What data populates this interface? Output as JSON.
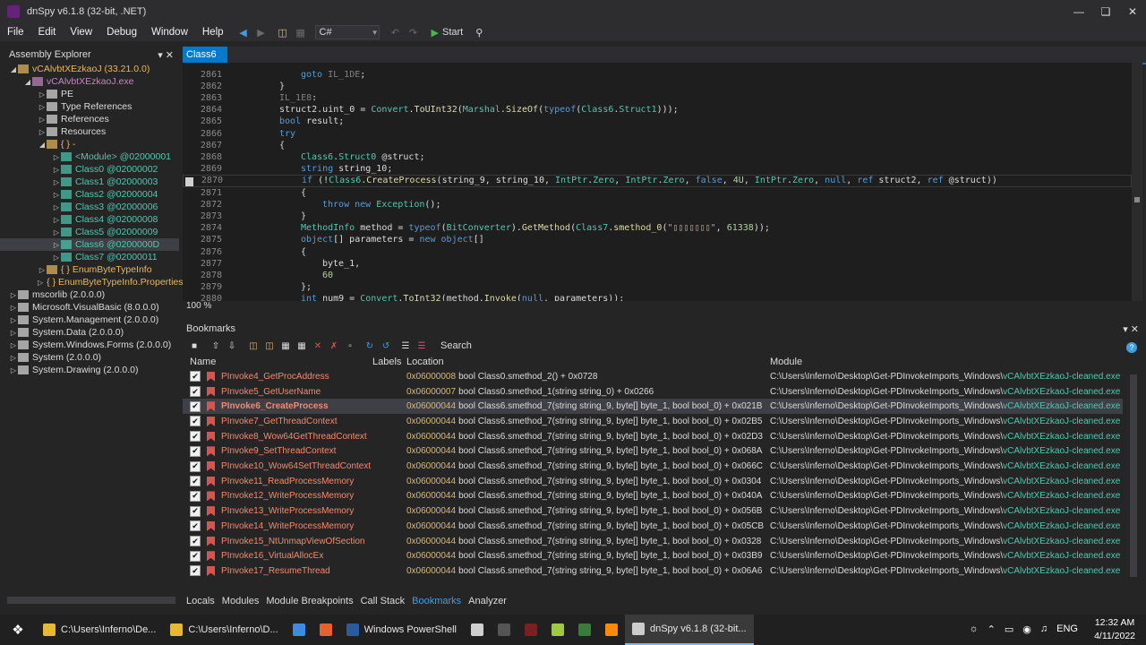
{
  "window": {
    "title": "dnSpy v6.1.8 (32-bit, .NET)"
  },
  "menu": [
    "File",
    "Edit",
    "View",
    "Debug",
    "Window",
    "Help"
  ],
  "toolbar": {
    "language": "C#",
    "start_label": "Start"
  },
  "assembly_explorer": {
    "title": "Assembly Explorer",
    "items": [
      {
        "label": "vCAlvbtXEzkaoJ (33.21.0.0)",
        "indent": 0,
        "color": "#e8b85a",
        "exp": "open"
      },
      {
        "label": "vCAlvbtXEzkaoJ.exe",
        "indent": 1,
        "color": "#c586c0",
        "exp": "open"
      },
      {
        "label": "PE",
        "indent": 2,
        "color": "#dcdcdc",
        "exp": "closed"
      },
      {
        "label": "Type References",
        "indent": 2,
        "color": "#dcdcdc",
        "exp": "closed"
      },
      {
        "label": "References",
        "indent": 2,
        "color": "#dcdcdc",
        "exp": "closed"
      },
      {
        "label": "Resources",
        "indent": 2,
        "color": "#dcdcdc",
        "exp": "closed"
      },
      {
        "label": "{ } -",
        "indent": 2,
        "color": "#e8b85a",
        "exp": "open"
      },
      {
        "label": "<Module> @02000001",
        "indent": 3,
        "color": "#4ec9b0",
        "exp": "closed"
      },
      {
        "label": "Class0 @02000002",
        "indent": 3,
        "color": "#4ec9b0",
        "exp": "closed"
      },
      {
        "label": "Class1 @02000003",
        "indent": 3,
        "color": "#4ec9b0",
        "exp": "closed"
      },
      {
        "label": "Class2 @02000004",
        "indent": 3,
        "color": "#4ec9b0",
        "exp": "closed"
      },
      {
        "label": "Class3 @02000006",
        "indent": 3,
        "color": "#4ec9b0",
        "exp": "closed"
      },
      {
        "label": "Class4 @02000008",
        "indent": 3,
        "color": "#4ec9b0",
        "exp": "closed"
      },
      {
        "label": "Class5 @02000009",
        "indent": 3,
        "color": "#4ec9b0",
        "exp": "closed"
      },
      {
        "label": "Class6 @0200000D",
        "indent": 3,
        "color": "#4ec9b0",
        "exp": "closed",
        "selected": true
      },
      {
        "label": "Class7 @02000011",
        "indent": 3,
        "color": "#4ec9b0",
        "exp": "closed"
      },
      {
        "label": "{ } EnumByteTypeInfo",
        "indent": 2,
        "color": "#e8b85a",
        "exp": "closed"
      },
      {
        "label": "{ } EnumByteTypeInfo.Properties",
        "indent": 2,
        "color": "#e8b85a",
        "exp": "closed"
      },
      {
        "label": "mscorlib (2.0.0.0)",
        "indent": 0,
        "color": "#dcdcdc",
        "exp": "closed"
      },
      {
        "label": "Microsoft.VisualBasic (8.0.0.0)",
        "indent": 0,
        "color": "#dcdcdc",
        "exp": "closed"
      },
      {
        "label": "System.Management (2.0.0.0)",
        "indent": 0,
        "color": "#dcdcdc",
        "exp": "closed"
      },
      {
        "label": "System.Data (2.0.0.0)",
        "indent": 0,
        "color": "#dcdcdc",
        "exp": "closed"
      },
      {
        "label": "System.Windows.Forms (2.0.0.0)",
        "indent": 0,
        "color": "#dcdcdc",
        "exp": "closed"
      },
      {
        "label": "System (2.0.0.0)",
        "indent": 0,
        "color": "#dcdcdc",
        "exp": "closed"
      },
      {
        "label": "System.Drawing (2.0.0.0)",
        "indent": 0,
        "color": "#dcdcdc",
        "exp": "closed"
      }
    ]
  },
  "editor": {
    "tab": "Class6",
    "zoom": "100 %",
    "lines": [
      {
        "n": "2861",
        "i": 3,
        "t": [
          [
            "kw",
            "goto "
          ],
          [
            "lb",
            "IL_1DE"
          ],
          [
            "pl",
            ";"
          ]
        ]
      },
      {
        "n": "2862",
        "i": 2,
        "t": [
          [
            "pl",
            "}"
          ]
        ]
      },
      {
        "n": "2863",
        "i": 2,
        "t": [
          [
            "lb",
            "IL_1E8"
          ],
          [
            "pl",
            ":"
          ]
        ]
      },
      {
        "n": "2864",
        "i": 2,
        "t": [
          [
            "pl",
            "struct2."
          ],
          [
            "pl",
            "uint_0"
          ],
          [
            "pl",
            " = "
          ],
          [
            "ty",
            "Convert"
          ],
          [
            "pl",
            "."
          ],
          [
            "mt",
            "ToUInt32"
          ],
          [
            "pl",
            "("
          ],
          [
            "ty",
            "Marshal"
          ],
          [
            "pl",
            "."
          ],
          [
            "mt",
            "SizeOf"
          ],
          [
            "pl",
            "("
          ],
          [
            "kw",
            "typeof"
          ],
          [
            "pl",
            "("
          ],
          [
            "ty",
            "Class6"
          ],
          [
            "pl",
            "."
          ],
          [
            "ty",
            "Struct1"
          ],
          [
            "pl",
            ")));"
          ]
        ]
      },
      {
        "n": "2865",
        "i": 2,
        "t": [
          [
            "kw",
            "bool"
          ],
          [
            "pl",
            " result;"
          ]
        ]
      },
      {
        "n": "2866",
        "i": 2,
        "t": [
          [
            "kw",
            "try"
          ]
        ]
      },
      {
        "n": "2867",
        "i": 2,
        "t": [
          [
            "pl",
            "{"
          ]
        ]
      },
      {
        "n": "2868",
        "i": 3,
        "t": [
          [
            "ty",
            "Class6"
          ],
          [
            "pl",
            "."
          ],
          [
            "ty",
            "Struct0"
          ],
          [
            "pl",
            " @struct;"
          ]
        ]
      },
      {
        "n": "2869",
        "i": 3,
        "t": [
          [
            "kw",
            "string"
          ],
          [
            "pl",
            " string_10;"
          ]
        ]
      },
      {
        "n": "2870",
        "i": 3,
        "hl": true,
        "t": [
          [
            "kw",
            "if"
          ],
          [
            "pl",
            " (!"
          ],
          [
            "ty",
            "Class6"
          ],
          [
            "pl",
            "."
          ],
          [
            "mt",
            "CreateProcess"
          ],
          [
            "pl",
            "("
          ],
          [
            "pl",
            "string_9"
          ],
          [
            "pl",
            ", string_10, "
          ],
          [
            "ty",
            "IntPtr"
          ],
          [
            "pl",
            "."
          ],
          [
            "ty",
            "Zero"
          ],
          [
            "pl",
            ", "
          ],
          [
            "ty",
            "IntPtr"
          ],
          [
            "pl",
            "."
          ],
          [
            "ty",
            "Zero"
          ],
          [
            "pl",
            ", "
          ],
          [
            "kw",
            "false"
          ],
          [
            "pl",
            ", "
          ],
          [
            "nm",
            "4U"
          ],
          [
            "pl",
            ", "
          ],
          [
            "ty",
            "IntPtr"
          ],
          [
            "pl",
            "."
          ],
          [
            "ty",
            "Zero"
          ],
          [
            "pl",
            ", "
          ],
          [
            "kw",
            "null"
          ],
          [
            "pl",
            ", "
          ],
          [
            "kw",
            "ref"
          ],
          [
            "pl",
            " struct2, "
          ],
          [
            "kw",
            "ref"
          ],
          [
            "pl",
            " @struct))"
          ]
        ]
      },
      {
        "n": "2871",
        "i": 3,
        "t": [
          [
            "pl",
            "{"
          ]
        ]
      },
      {
        "n": "2872",
        "i": 4,
        "t": [
          [
            "kw",
            "throw new "
          ],
          [
            "ty",
            "Exception"
          ],
          [
            "pl",
            "();"
          ]
        ]
      },
      {
        "n": "2873",
        "i": 3,
        "t": [
          [
            "pl",
            "}"
          ]
        ]
      },
      {
        "n": "2874",
        "i": 3,
        "t": [
          [
            "ty",
            "MethodInfo"
          ],
          [
            "pl",
            " method = "
          ],
          [
            "kw",
            "typeof"
          ],
          [
            "pl",
            "("
          ],
          [
            "ty",
            "BitConverter"
          ],
          [
            "pl",
            ")."
          ],
          [
            "mt",
            "GetMethod"
          ],
          [
            "pl",
            "("
          ],
          [
            "ty",
            "Class7"
          ],
          [
            "pl",
            "."
          ],
          [
            "mt",
            "smethod_0"
          ],
          [
            "pl",
            "("
          ],
          [
            "st",
            "\"▯▯▯▯▯▯▯\""
          ],
          [
            "pl",
            ", "
          ],
          [
            "nm",
            "61338"
          ],
          [
            "pl",
            "));"
          ]
        ]
      },
      {
        "n": "2875",
        "i": 3,
        "t": [
          [
            "kw",
            "object"
          ],
          [
            "pl",
            "[] parameters = "
          ],
          [
            "kw",
            "new object"
          ],
          [
            "pl",
            "[]"
          ]
        ]
      },
      {
        "n": "2876",
        "i": 3,
        "t": [
          [
            "pl",
            "{"
          ]
        ]
      },
      {
        "n": "2877",
        "i": 4,
        "t": [
          [
            "pl",
            "byte_1,"
          ]
        ]
      },
      {
        "n": "2878",
        "i": 4,
        "t": [
          [
            "nm",
            "60"
          ]
        ]
      },
      {
        "n": "2879",
        "i": 3,
        "t": [
          [
            "pl",
            "};"
          ]
        ]
      },
      {
        "n": "2880",
        "i": 3,
        "t": [
          [
            "kw",
            "int"
          ],
          [
            "pl",
            " num9 = "
          ],
          [
            "ty",
            "Convert"
          ],
          [
            "pl",
            "."
          ],
          [
            "mt",
            "ToInt32"
          ],
          [
            "pl",
            "(method."
          ],
          [
            "mt",
            "Invoke"
          ],
          [
            "pl",
            "("
          ],
          [
            "kw",
            "null"
          ],
          [
            "pl",
            ", parameters));"
          ]
        ]
      }
    ]
  },
  "bookmarks": {
    "title": "Bookmarks",
    "search_label": "Search",
    "columns": {
      "name": "Name",
      "labels": "Labels",
      "location": "Location",
      "module": "Module"
    },
    "rows": [
      {
        "name": "PInvoke4_GetProcAddress",
        "token": "0x06000008",
        "sig": "bool Class0.smethod_2() + 0x0728",
        "module": "C:\\Users\\Inferno\\Desktop\\Get-PDInvokeImports_Windows\\",
        "exe": "vCAlvbtXEzkaoJ-cleaned.exe"
      },
      {
        "name": "PInvoke5_GetUserName",
        "token": "0x06000007",
        "sig": "bool Class0.smethod_1(string string_0) + 0x0266",
        "module": "C:\\Users\\Inferno\\Desktop\\Get-PDInvokeImports_Windows\\",
        "exe": "vCAlvbtXEzkaoJ-cleaned.exe"
      },
      {
        "name": "PInvoke6_CreateProcess",
        "token": "0x06000044",
        "sig": "bool Class6.smethod_7(string string_9, byte[] byte_1, bool bool_0) + 0x021B",
        "module": "C:\\Users\\Inferno\\Desktop\\Get-PDInvokeImports_Windows\\",
        "exe": "vCAlvbtXEzkaoJ-cleaned.exe",
        "selected": true
      },
      {
        "name": "PInvoke7_GetThreadContext",
        "token": "0x06000044",
        "sig": "bool Class6.smethod_7(string string_9, byte[] byte_1, bool bool_0) + 0x02B5",
        "module": "C:\\Users\\Inferno\\Desktop\\Get-PDInvokeImports_Windows\\",
        "exe": "vCAlvbtXEzkaoJ-cleaned.exe"
      },
      {
        "name": "PInvoke8_Wow64GetThreadContext",
        "token": "0x06000044",
        "sig": "bool Class6.smethod_7(string string_9, byte[] byte_1, bool bool_0) + 0x02D3",
        "module": "C:\\Users\\Inferno\\Desktop\\Get-PDInvokeImports_Windows\\",
        "exe": "vCAlvbtXEzkaoJ-cleaned.exe"
      },
      {
        "name": "PInvoke9_SetThreadContext",
        "token": "0x06000044",
        "sig": "bool Class6.smethod_7(string string_9, byte[] byte_1, bool bool_0) + 0x068A",
        "module": "C:\\Users\\Inferno\\Desktop\\Get-PDInvokeImports_Windows\\",
        "exe": "vCAlvbtXEzkaoJ-cleaned.exe"
      },
      {
        "name": "PInvoke10_Wow64SetThreadContext",
        "token": "0x06000044",
        "sig": "bool Class6.smethod_7(string string_9, byte[] byte_1, bool bool_0) + 0x066C",
        "module": "C:\\Users\\Inferno\\Desktop\\Get-PDInvokeImports_Windows\\",
        "exe": "vCAlvbtXEzkaoJ-cleaned.exe"
      },
      {
        "name": "PInvoke11_ReadProcessMemory",
        "token": "0x06000044",
        "sig": "bool Class6.smethod_7(string string_9, byte[] byte_1, bool bool_0) + 0x0304",
        "module": "C:\\Users\\Inferno\\Desktop\\Get-PDInvokeImports_Windows\\",
        "exe": "vCAlvbtXEzkaoJ-cleaned.exe"
      },
      {
        "name": "PInvoke12_WriteProcessMemory",
        "token": "0x06000044",
        "sig": "bool Class6.smethod_7(string string_9, byte[] byte_1, bool bool_0) + 0x040A",
        "module": "C:\\Users\\Inferno\\Desktop\\Get-PDInvokeImports_Windows\\",
        "exe": "vCAlvbtXEzkaoJ-cleaned.exe"
      },
      {
        "name": "PInvoke13_WriteProcessMemory",
        "token": "0x06000044",
        "sig": "bool Class6.smethod_7(string string_9, byte[] byte_1, bool bool_0) + 0x056B",
        "module": "C:\\Users\\Inferno\\Desktop\\Get-PDInvokeImports_Windows\\",
        "exe": "vCAlvbtXEzkaoJ-cleaned.exe"
      },
      {
        "name": "PInvoke14_WriteProcessMemory",
        "token": "0x06000044",
        "sig": "bool Class6.smethod_7(string string_9, byte[] byte_1, bool bool_0) + 0x05CB",
        "module": "C:\\Users\\Inferno\\Desktop\\Get-PDInvokeImports_Windows\\",
        "exe": "vCAlvbtXEzkaoJ-cleaned.exe"
      },
      {
        "name": "PInvoke15_NtUnmapViewOfSection",
        "token": "0x06000044",
        "sig": "bool Class6.smethod_7(string string_9, byte[] byte_1, bool bool_0) + 0x0328",
        "module": "C:\\Users\\Inferno\\Desktop\\Get-PDInvokeImports_Windows\\",
        "exe": "vCAlvbtXEzkaoJ-cleaned.exe"
      },
      {
        "name": "PInvoke16_VirtualAllocEx",
        "token": "0x06000044",
        "sig": "bool Class6.smethod_7(string string_9, byte[] byte_1, bool bool_0) + 0x03B9",
        "module": "C:\\Users\\Inferno\\Desktop\\Get-PDInvokeImports_Windows\\",
        "exe": "vCAlvbtXEzkaoJ-cleaned.exe"
      },
      {
        "name": "PInvoke17_ResumeThread",
        "token": "0x06000044",
        "sig": "bool Class6.smethod_7(string string_9, byte[] byte_1, bool bool_0) + 0x06A6",
        "module": "C:\\Users\\Inferno\\Desktop\\Get-PDInvokeImports_Windows\\",
        "exe": "vCAlvbtXEzkaoJ-cleaned.exe"
      }
    ]
  },
  "bottom_tabs": [
    "Locals",
    "Modules",
    "Module Breakpoints",
    "Call Stack",
    "Bookmarks",
    "Analyzer"
  ],
  "bottom_tab_active": "Bookmarks",
  "taskbar": {
    "items": [
      {
        "label": "C:\\Users\\Inferno\\De...",
        "icon": "folder-icon",
        "color": "#e8b830"
      },
      {
        "label": "C:\\Users\\Inferno\\D...",
        "icon": "folder-icon",
        "color": "#e8b830"
      },
      {
        "label": "",
        "icon": "chrome-icon",
        "color": "#3b8be0"
      },
      {
        "label": "",
        "icon": "firefox-icon",
        "color": "#e8602c"
      },
      {
        "label": "Windows PowerShell",
        "icon": "powershell-icon",
        "color": "#2a5aa0"
      },
      {
        "label": "",
        "icon": "app-icon",
        "color": "#cfcfcf"
      },
      {
        "label": "",
        "icon": "bug-icon",
        "color": "#555555"
      },
      {
        "label": "",
        "icon": "bug-icon",
        "color": "#7a2020"
      },
      {
        "label": "",
        "icon": "notepad-icon",
        "color": "#a0c840"
      },
      {
        "label": "",
        "icon": "terminal-icon",
        "color": "#3a7a3a"
      },
      {
        "label": "",
        "icon": "search-icon",
        "color": "#ff8a00"
      },
      {
        "label": "dnSpy v6.1.8 (32-bit...",
        "icon": "dnspy-icon",
        "color": "#cccccc"
      }
    ],
    "lang": "ENG",
    "time": "12:32 AM",
    "date": "4/11/2022"
  }
}
